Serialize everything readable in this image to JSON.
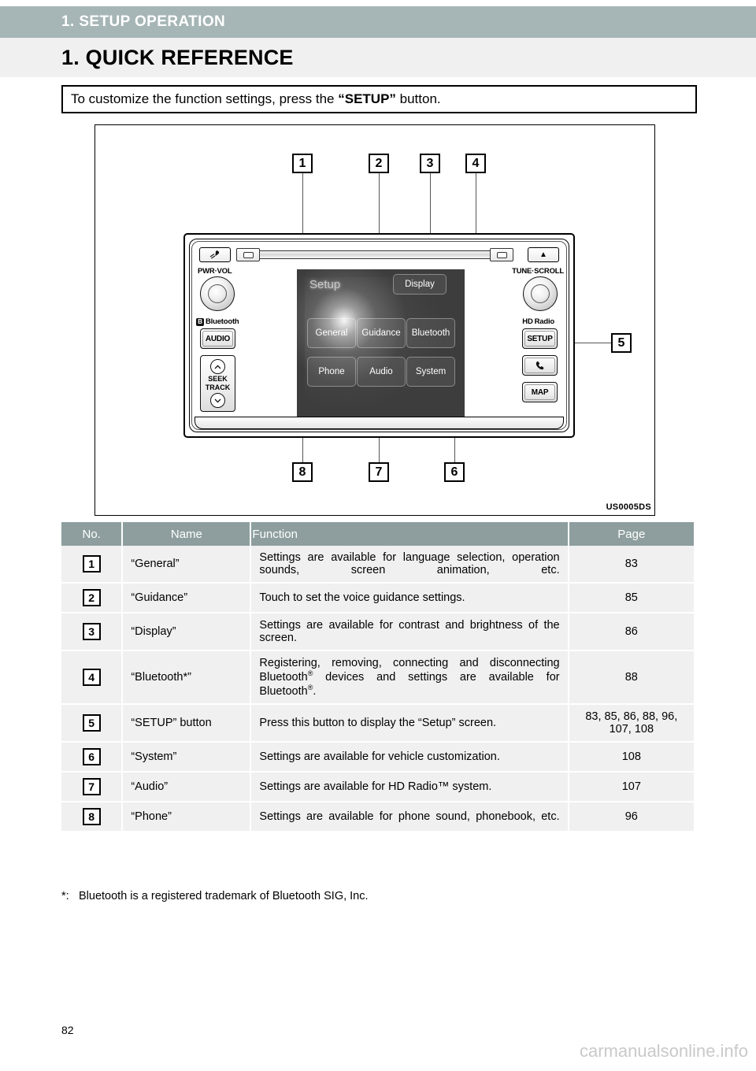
{
  "header": {
    "chapter": "1. SETUP OPERATION",
    "section": "1. QUICK REFERENCE"
  },
  "intro": {
    "before": "To customize the function settings, press the ",
    "emphasis": "“SETUP”",
    "after": " button."
  },
  "figure": {
    "code": "US0005DS",
    "callouts": [
      "1",
      "2",
      "3",
      "4",
      "5",
      "6",
      "7",
      "8"
    ],
    "unit": {
      "left_controls": {
        "mic_icon": "microphone-icon",
        "pwr_vol_label": "PWR·VOL",
        "bluetooth_label": "Bluetooth",
        "audio_label": "AUDIO",
        "seek_label": "SEEK",
        "track_label": "TRACK",
        "chevron_up": "⌃",
        "chevron_down": "⌄"
      },
      "right_controls": {
        "eject_icon": "▲",
        "tune_scroll_label": "TUNE·SCROLL",
        "hd_radio_label": "Radio",
        "hd_mark": "HD",
        "setup_label": "SETUP",
        "phone_icon": "☎",
        "map_label": "MAP"
      },
      "screen": {
        "title": "Setup",
        "display_button": "Display",
        "tiles": [
          "General",
          "Guidance",
          "Bluetooth",
          "Phone",
          "Audio",
          "System"
        ]
      }
    }
  },
  "table": {
    "columns": [
      "No.",
      "Name",
      "Function",
      "Page"
    ],
    "rows": [
      {
        "no": "1",
        "name": "“General”",
        "function": "Settings are available for language selection, operation sounds, screen animation, etc.",
        "page": "83"
      },
      {
        "no": "2",
        "name": "“Guidance”",
        "function": "Touch to set the voice guidance settings.",
        "page": "85"
      },
      {
        "no": "3",
        "name": "“Display”",
        "function": "Settings are available for contrast and brightness of the screen.",
        "page": "86"
      },
      {
        "no": "4",
        "name": "“Bluetooth*”",
        "function": "Registering, removing, connecting and disconnecting Bluetooth® devices and settings are available for Bluetooth®.",
        "page": "88"
      },
      {
        "no": "5",
        "name": "“SETUP” button",
        "function": "Press this button to display the “Setup” screen.",
        "page": "83, 85, 86, 88, 96, 107, 108"
      },
      {
        "no": "6",
        "name": "“System”",
        "function": "Settings are available for vehicle customization.",
        "page": "108"
      },
      {
        "no": "7",
        "name": "“Audio”",
        "function": "Settings are available for HD Radio™ system.",
        "page": "107"
      },
      {
        "no": "8",
        "name": "“Phone”",
        "function": "Settings are available for phone sound, phonebook, etc.",
        "page": "96"
      }
    ]
  },
  "footnote": {
    "marker": "*:",
    "text": "Bluetooth is a registered trademark of Bluetooth SIG, Inc."
  },
  "page_number": "82",
  "watermark": "carmanualsonline.info",
  "colors": {
    "chapter_bar": "#a6b5b5",
    "section_bar": "#f0f0f0",
    "table_header": "#8e9e9e",
    "table_row": "#f0f0f0",
    "screen_bg": "#3d3d3d"
  }
}
